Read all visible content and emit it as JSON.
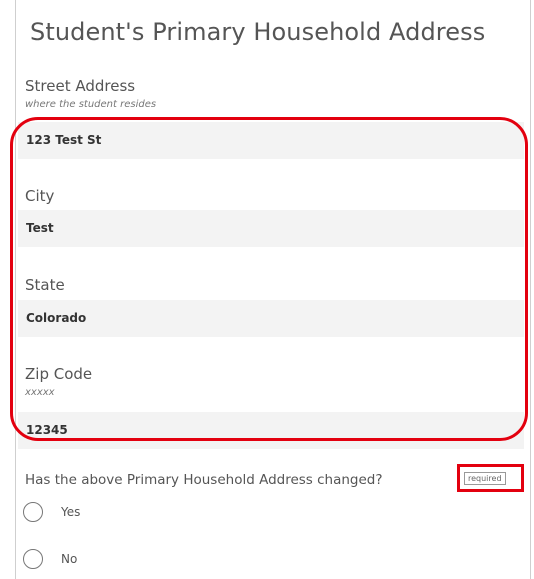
{
  "section": {
    "title": "Student's Primary Household Address"
  },
  "fields": {
    "street": {
      "label": "Street Address",
      "hint": "where the student resides",
      "value": "123 Test St"
    },
    "city": {
      "label": "City",
      "value": "Test"
    },
    "state": {
      "label": "State",
      "value": "Colorado"
    },
    "zip": {
      "label": "Zip Code",
      "hint": "xxxxx",
      "value": "12345"
    }
  },
  "question": {
    "text": "Has the above Primary Household Address changed?",
    "required_label": "required",
    "options": [
      "Yes",
      "No"
    ]
  },
  "colors": {
    "highlight": "#e3000f",
    "field_background": "#f3f3f3",
    "text": "#555555"
  }
}
